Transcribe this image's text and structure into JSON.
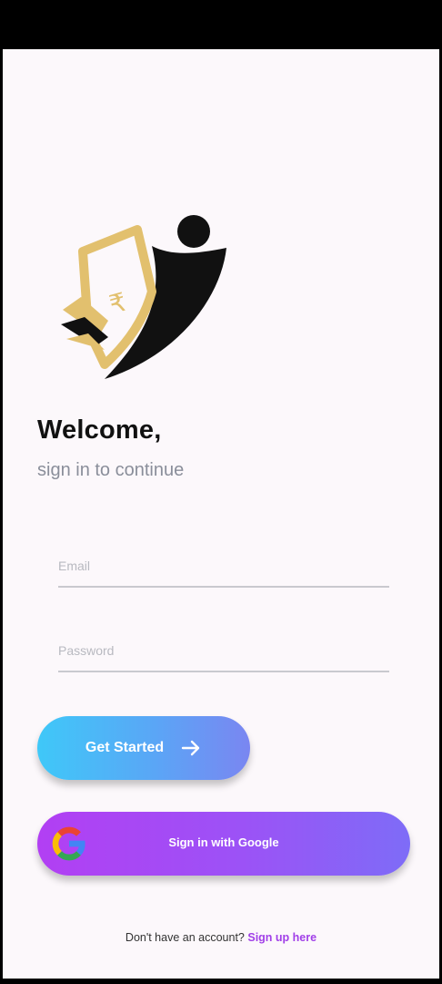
{
  "header": {
    "title": "Welcome,",
    "subtitle": "sign in to continue"
  },
  "form": {
    "email_placeholder": "Email",
    "password_placeholder": "Password",
    "get_started_label": "Get Started",
    "google_label": "Sign in with Google"
  },
  "footer": {
    "prompt": "Don't have an account?",
    "link_label": "Sign up here"
  },
  "icons": {
    "logo": "money-figure-logo",
    "arrow": "arrow-right-icon",
    "google": "google-icon",
    "rupee": "rupee-symbol"
  },
  "colors": {
    "logo_gold": "#e2c06e",
    "logo_black": "#111111",
    "get_started_start": "#3fc8f8",
    "get_started_end": "#7a86f1",
    "google_start": "#b23ff3",
    "google_end": "#7e6cf7",
    "link": "#a13fe8"
  }
}
